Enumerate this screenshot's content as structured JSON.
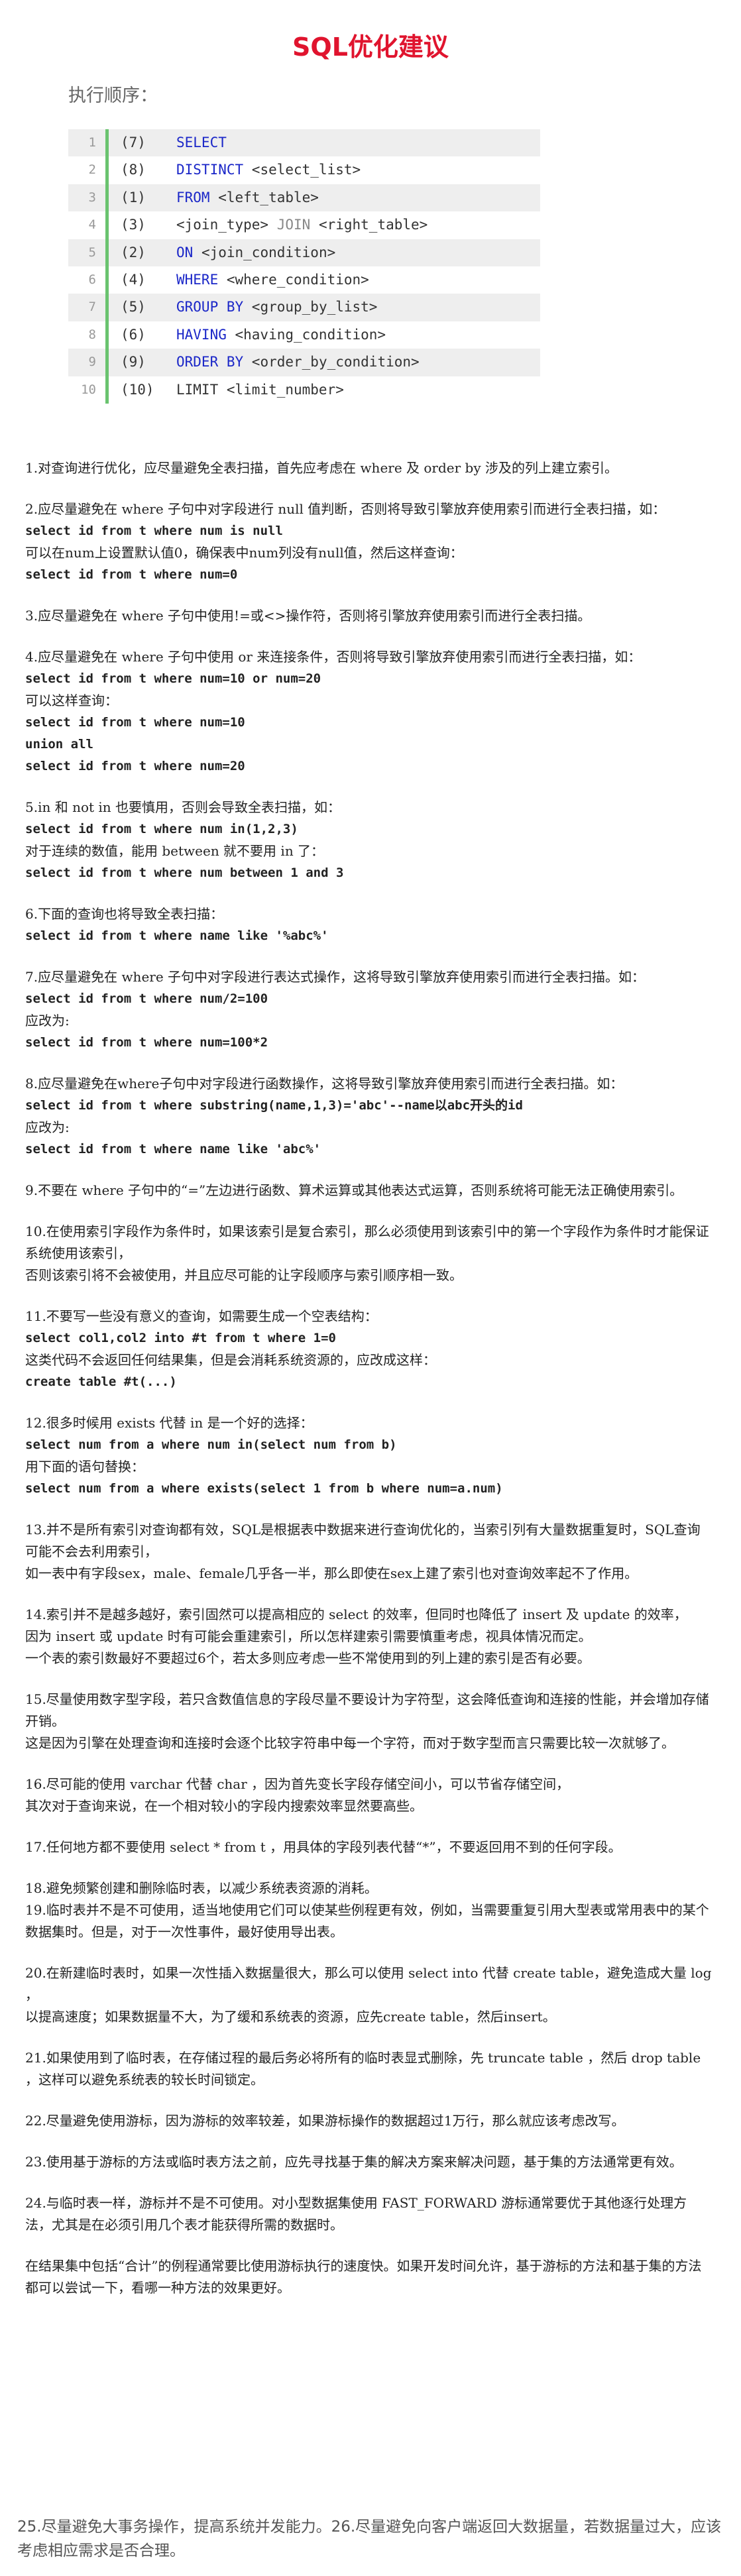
{
  "title": "SQL优化建议",
  "exec_label": "执行顺序：",
  "exec_rows": [
    {
      "ln": "1",
      "step": "(7)",
      "kw": "SELECT",
      "rest": ""
    },
    {
      "ln": "2",
      "step": "(8)",
      "kw": "DISTINCT",
      "rest": " <select_list>"
    },
    {
      "ln": "3",
      "step": "(1)",
      "kw": "FROM",
      "rest": " <left_table>"
    },
    {
      "ln": "4",
      "step": "(3)",
      "kw": "",
      "rest": "<join_type> ",
      "gray": "JOIN",
      "rest2": " <right_table>"
    },
    {
      "ln": "5",
      "step": "(2)",
      "kw": "ON",
      "rest": " <join_condition>"
    },
    {
      "ln": "6",
      "step": "(4)",
      "kw": "WHERE",
      "rest": " <where_condition>"
    },
    {
      "ln": "7",
      "step": "(5)",
      "kw": "GROUP BY",
      "rest": " <group_by_list>"
    },
    {
      "ln": "8",
      "step": "(6)",
      "kw": "HAVING",
      "rest": " <having_condition>"
    },
    {
      "ln": "9",
      "step": "(9)",
      "kw": "ORDER BY",
      "rest": " <order_by_condition>"
    },
    {
      "ln": "10",
      "step": "(10)",
      "kw": "",
      "rest": "LIMIT <limit_number>"
    }
  ],
  "paragraphs": [
    [
      "1.对查询进行优化，应尽量避免全表扫描，首先应考虑在 where 及 order by 涉及的列上建立索引。"
    ],
    [
      "2.应尽量避免在 where 子句中对字段进行 null 值判断，否则将导致引擎放弃使用索引而进行全表扫描，如：",
      "select id from t where num is null",
      "可以在num上设置默认值0，确保表中num列没有null值，然后这样查询：",
      "select id from t where num=0"
    ],
    [
      "3.应尽量避免在 where 子句中使用!=或<>操作符，否则将引擎放弃使用索引而进行全表扫描。"
    ],
    [
      "4.应尽量避免在 where 子句中使用 or 来连接条件，否则将导致引擎放弃使用索引而进行全表扫描，如：",
      "select id from t where num=10 or num=20",
      "可以这样查询：",
      "select id from t where num=10",
      "union all",
      "select id from t where num=20"
    ],
    [
      "5.in 和 not in 也要慎用，否则会导致全表扫描，如：",
      "select id from t where num in(1,2,3)",
      "对于连续的数值，能用 between 就不要用 in 了：",
      "select id from t where num between 1 and 3"
    ],
    [
      "6.下面的查询也将导致全表扫描：",
      "select id from t where name like '%abc%'"
    ],
    [
      "7.应尽量避免在 where 子句中对字段进行表达式操作，这将导致引擎放弃使用索引而进行全表扫描。如：",
      "select id from t where num/2=100",
      "应改为:",
      "select id from t where num=100*2"
    ],
    [
      "8.应尽量避免在where子句中对字段进行函数操作，这将导致引擎放弃使用索引而进行全表扫描。如：",
      "select id from t where substring(name,1,3)='abc'--name以abc开头的id",
      "应改为:",
      "select id from t where name like 'abc%'"
    ],
    [
      "9.不要在 where 子句中的“=”左边进行函数、算术运算或其他表达式运算，否则系统将可能无法正确使用索引。"
    ],
    [
      "10.在使用索引字段作为条件时，如果该索引是复合索引，那么必须使用到该索引中的第一个字段作为条件时才能保证系统使用该索引，",
      "否则该索引将不会被使用，并且应尽可能的让字段顺序与索引顺序相一致。"
    ],
    [
      "11.不要写一些没有意义的查询，如需要生成一个空表结构：",
      "select col1,col2 into #t from t where 1=0",
      "这类代码不会返回任何结果集，但是会消耗系统资源的，应改成这样：",
      "create table #t(...)"
    ],
    [
      "12.很多时候用 exists 代替 in 是一个好的选择：",
      "select num from a where num in(select num from b)",
      "用下面的语句替换：",
      "select num from a where exists(select 1 from b where num=a.num)"
    ],
    [
      "13.并不是所有索引对查询都有效，SQL是根据表中数据来进行查询优化的，当索引列有大量数据重复时，SQL查询可能不会去利用索引，",
      "如一表中有字段sex，male、female几乎各一半，那么即使在sex上建了索引也对查询效率起不了作用。"
    ],
    [
      "14.索引并不是越多越好，索引固然可以提高相应的 select 的效率，但同时也降低了 insert 及 update 的效率，",
      "因为 insert 或 update 时有可能会重建索引，所以怎样建索引需要慎重考虑，视具体情况而定。",
      "一个表的索引数最好不要超过6个，若太多则应考虑一些不常使用到的列上建的索引是否有必要。"
    ],
    [
      "15.尽量使用数字型字段，若只含数值信息的字段尽量不要设计为字符型，这会降低查询和连接的性能，并会增加存储开销。",
      "这是因为引擎在处理查询和连接时会逐个比较字符串中每一个字符，而对于数字型而言只需要比较一次就够了。"
    ],
    [
      "16.尽可能的使用 varchar 代替 char ，因为首先变长字段存储空间小，可以节省存储空间，",
      "其次对于查询来说，在一个相对较小的字段内搜索效率显然要高些。"
    ],
    [
      "17.任何地方都不要使用 select * from t ，用具体的字段列表代替“*”，不要返回用不到的任何字段。"
    ],
    [
      "18.避免频繁创建和删除临时表，以减少系统表资源的消耗。",
      "19.临时表并不是不可使用，适当地使用它们可以使某些例程更有效，例如，当需要重复引用大型表或常用表中的某个数据集时。但是，对于一次性事件，最好使用导出表。"
    ],
    [
      "20.在新建临时表时，如果一次性插入数据量很大，那么可以使用 select into 代替 create table，避免造成大量 log ，",
      "以提高速度；如果数据量不大，为了缓和系统表的资源，应先create table，然后insert。"
    ],
    [
      "21.如果使用到了临时表，在存储过程的最后务必将所有的临时表显式删除，先 truncate table ，然后 drop table ，这样可以避免系统表的较长时间锁定。"
    ],
    [
      "22.尽量避免使用游标，因为游标的效率较差，如果游标操作的数据超过1万行，那么就应该考虑改写。"
    ],
    [
      "23.使用基于游标的方法或临时表方法之前，应先寻找基于集的解决方案来解决问题，基于集的方法通常更有效。"
    ],
    [
      "24.与临时表一样，游标并不是不可使用。对小型数据集使用 FAST_FORWARD 游标通常要优于其他逐行处理方法，尤其是在必须引用几个表才能获得所需的数据时。"
    ],
    [
      "在结果集中包括“合计”的例程通常要比使用游标执行的速度快。如果开发时间允许，基于游标的方法和基于集的方法都可以尝试一下，看哪一种方法的效果更好。"
    ]
  ],
  "footer": "25.尽量避免大事务操作，提高系统并发能力。26.尽量避免向客户端返回大数据量，若数据量过大，应该考虑相应需求是否合理。"
}
